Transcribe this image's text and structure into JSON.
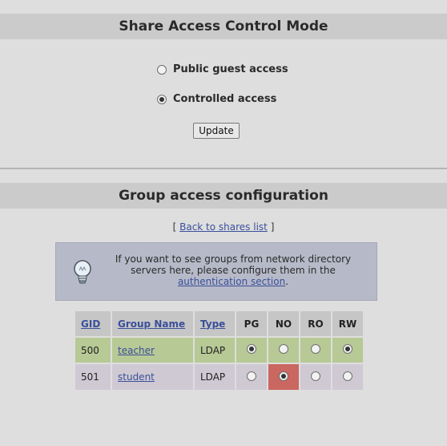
{
  "mode_section": {
    "title": "Share Access Control Mode",
    "options": [
      {
        "label": "Public guest access",
        "checked": false
      },
      {
        "label": "Controlled access",
        "checked": true
      }
    ],
    "update_label": "Update"
  },
  "group_section": {
    "title": "Group access configuration",
    "back_prefix": "[",
    "back_link": "Back to shares list",
    "back_suffix": "]",
    "info": {
      "line1": "If you want to see groups from network directory",
      "line2": "servers here, please configure them in the",
      "link": "authentication section",
      "after_link": "."
    },
    "table": {
      "headers": {
        "gid": "GID",
        "name": "Group Name",
        "type": "Type",
        "pg": "PG",
        "no": "NO",
        "ro": "RO",
        "rw": "RW"
      },
      "rows": [
        {
          "gid": "500",
          "name": "teacher",
          "type": "LDAP",
          "selected": [
            "PG",
            "RW"
          ]
        },
        {
          "gid": "501",
          "name": "student",
          "type": "LDAP",
          "selected": [
            "NO"
          ]
        }
      ]
    }
  },
  "colors": {
    "header_bg": "#cbcbcb",
    "row_teacher": "#b7c995",
    "row_student": "#cfc9d3",
    "no_highlight": "#c96760",
    "info_bg": "#b6bac8",
    "link": "#3a4f9a"
  }
}
